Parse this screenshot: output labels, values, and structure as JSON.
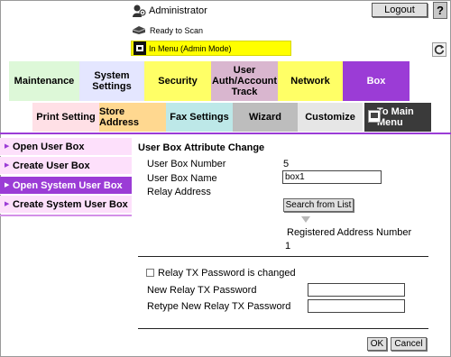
{
  "header": {
    "user_label": "Administrator",
    "logout_label": "Logout",
    "help_label": "?",
    "status_text": "Ready to Scan",
    "mode_text": "In Menu (Admin Mode)",
    "mode_color": "#ffff00"
  },
  "tabs": [
    {
      "label": "Maintenance"
    },
    {
      "label": "System Settings"
    },
    {
      "label": "Security"
    },
    {
      "label": "User Auth/Account Track"
    },
    {
      "label": "Network"
    },
    {
      "label": "Box",
      "active": true
    }
  ],
  "subtabs": [
    {
      "label": "Print Setting"
    },
    {
      "label": "Store Address"
    },
    {
      "label": "Fax Settings"
    },
    {
      "label": "Wizard"
    },
    {
      "label": "Customize"
    },
    {
      "label": "To Main Menu"
    }
  ],
  "sidebar": {
    "items": [
      {
        "label": "Open User Box"
      },
      {
        "label": "Create User Box"
      },
      {
        "label": "Open System User Box",
        "active": true
      },
      {
        "label": "Create System User Box"
      }
    ]
  },
  "main": {
    "title": "User Box Attribute Change",
    "box_number_label": "User Box Number",
    "box_number_value": "5",
    "box_name_label": "User Box Name",
    "box_name_value": "box1",
    "relay_address_label": "Relay Address",
    "search_button": "Search from List",
    "registered_label": "Registered Address Number",
    "registered_value": "1",
    "relay_pw_changed_label": "Relay TX Password is changed",
    "relay_pw_changed_checked": false,
    "new_pw_label": "New Relay TX Password",
    "retype_pw_label": "Retype New Relay TX Password",
    "ok_label": "OK",
    "cancel_label": "Cancel"
  },
  "colors": {
    "accent": "#9b3cd6",
    "sidebar_bg": "#fde0fb"
  }
}
